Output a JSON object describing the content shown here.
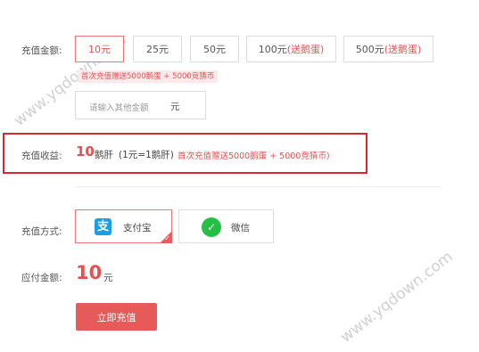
{
  "recharge": {
    "label": "充值金额:",
    "options": [
      {
        "text": "10元",
        "tag": ""
      },
      {
        "text": "25元",
        "tag": ""
      },
      {
        "text": "50元",
        "tag": ""
      },
      {
        "text": "100元",
        "tag": "(送鹅蛋)"
      },
      {
        "text": "500元",
        "tag": "(送鹅蛋)"
      }
    ],
    "selected": "10元",
    "promo_tip": "首次充值赠送5000鹅蛋 + 5000竞猜币",
    "custom_placeholder": "请输入其他金额",
    "custom_unit": "元"
  },
  "income": {
    "label": "充值收益:",
    "value": "10",
    "unit": "鹅肝",
    "rate": "(1元=1鹅肝)",
    "promo": "首次充值赠送5000鹅蛋 + 5000竞猜币)"
  },
  "payment": {
    "label": "充值方式:",
    "methods": [
      {
        "name": "支付宝",
        "icon": "alipay-icon",
        "color": "#1a9fe0"
      },
      {
        "name": "微信",
        "icon": "wechat-icon",
        "color": "#23c043"
      }
    ],
    "selected": "支付宝"
  },
  "due": {
    "label": "应付金额:",
    "value": "10",
    "unit": "元"
  },
  "submit_label": "立即充值",
  "watermark": "www.yqdown.com",
  "colors": {
    "accent": "#e75a5a",
    "highlight_border": "#d8272f"
  }
}
